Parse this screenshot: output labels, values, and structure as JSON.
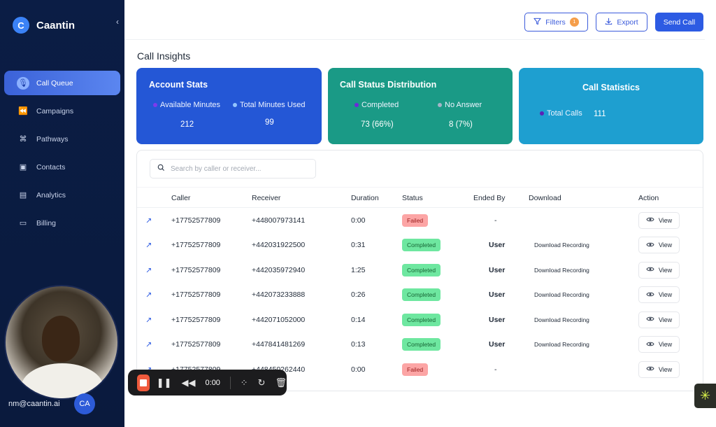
{
  "app": {
    "logo_letter": "C",
    "name": "Caantin"
  },
  "sidebar": {
    "items": [
      {
        "label": "Call Queue",
        "icon": "mic-icon"
      },
      {
        "label": "Campaigns",
        "icon": "rewind-icon"
      },
      {
        "label": "Pathways",
        "icon": "command-icon"
      },
      {
        "label": "Contacts",
        "icon": "contact-card-icon"
      },
      {
        "label": "Analytics",
        "icon": "chart-icon"
      },
      {
        "label": "Billing",
        "icon": "receipt-icon"
      }
    ],
    "user_email": "nm@caantin.ai",
    "user_initials": "CA"
  },
  "toolbar": {
    "filters_label": "Filters",
    "filters_count": "1",
    "export_label": "Export",
    "send_call_label": "Send Call"
  },
  "page": {
    "title": "Call Insights"
  },
  "cards": {
    "account": {
      "title": "Account Stats",
      "available_label": "Available Minutes",
      "available_value": "212",
      "used_label": "Total Minutes Used",
      "used_value": "99"
    },
    "distribution": {
      "title": "Call Status Distribution",
      "completed_label": "Completed",
      "completed_value": "73 (66%)",
      "no_answer_label": "No Answer",
      "no_answer_value": "8 (7%)"
    },
    "statistics": {
      "title": "Call Statistics",
      "total_label": "Total Calls",
      "total_value": "111"
    }
  },
  "search": {
    "placeholder": "Search by caller or receiver..."
  },
  "table": {
    "headers": {
      "caller": "Caller",
      "receiver": "Receiver",
      "duration": "Duration",
      "status": "Status",
      "ended_by": "Ended By",
      "download": "Download",
      "action": "Action"
    },
    "rows": [
      {
        "caller": "+17752577809",
        "receiver": "+448007973141",
        "duration": "0:00",
        "status": "Failed",
        "ended_by": "-",
        "download": "",
        "action": "View"
      },
      {
        "caller": "+17752577809",
        "receiver": "+442031922500",
        "duration": "0:31",
        "status": "Completed",
        "ended_by": "User",
        "download": "Download Recording",
        "action": "View"
      },
      {
        "caller": "+17752577809",
        "receiver": "+442035972940",
        "duration": "1:25",
        "status": "Completed",
        "ended_by": "User",
        "download": "Download Recording",
        "action": "View"
      },
      {
        "caller": "+17752577809",
        "receiver": "+442073233888",
        "duration": "0:26",
        "status": "Completed",
        "ended_by": "User",
        "download": "Download Recording",
        "action": "View"
      },
      {
        "caller": "+17752577809",
        "receiver": "+442071052000",
        "duration": "0:14",
        "status": "Completed",
        "ended_by": "User",
        "download": "Download Recording",
        "action": "View"
      },
      {
        "caller": "+17752577809",
        "receiver": "+447841481269",
        "duration": "0:13",
        "status": "Completed",
        "ended_by": "User",
        "download": "Download Recording",
        "action": "View"
      },
      {
        "caller": "+17752577809",
        "receiver": "+448450262440",
        "duration": "0:00",
        "status": "Failed",
        "ended_by": "-",
        "download": "",
        "action": "View"
      }
    ]
  },
  "recorder": {
    "time": "0:00"
  },
  "colors": {
    "accent": "#2d5be3",
    "sidebar_bg": "#0b1d45",
    "card_blue": "#2457d6",
    "card_green": "#1a9a86",
    "card_cyan": "#1e9fd0",
    "record_red": "#f05a3c"
  }
}
